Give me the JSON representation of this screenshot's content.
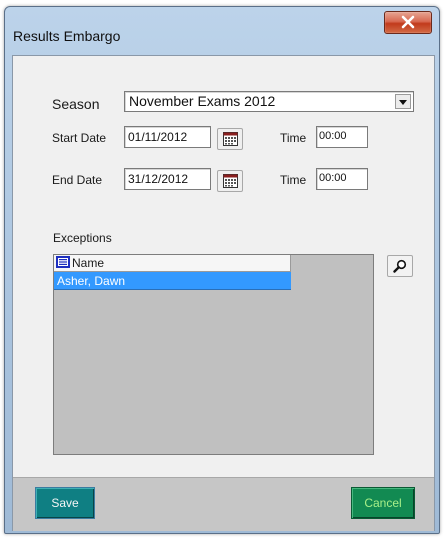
{
  "window": {
    "title": "Results Embargo"
  },
  "form": {
    "season_label": "Season",
    "season_value": "November Exams 2012",
    "start_date_label": "Start Date",
    "start_date_value": "01/11/2012",
    "start_time_label": "Time",
    "start_time_value": "00:00",
    "end_date_label": "End Date",
    "end_date_value": "31/12/2012",
    "end_time_label": "Time",
    "end_time_value": "00:00"
  },
  "exceptions": {
    "label": "Exceptions",
    "columns": [
      "Name"
    ],
    "rows": [
      {
        "name": "Asher, Dawn",
        "selected": true
      }
    ]
  },
  "buttons": {
    "save": "Save",
    "cancel": "Cancel"
  },
  "colors": {
    "selection": "#3399ff",
    "save_button": "#0f7f83",
    "cancel_button": "#128a52",
    "cancel_text": "#a7ef88",
    "close_button": "#c13a1c"
  },
  "icons": {
    "close": "close-icon",
    "calendar": "calendar-icon",
    "search": "search-icon",
    "column_header": "list-column-icon",
    "dropdown": "chevron-down-icon"
  }
}
